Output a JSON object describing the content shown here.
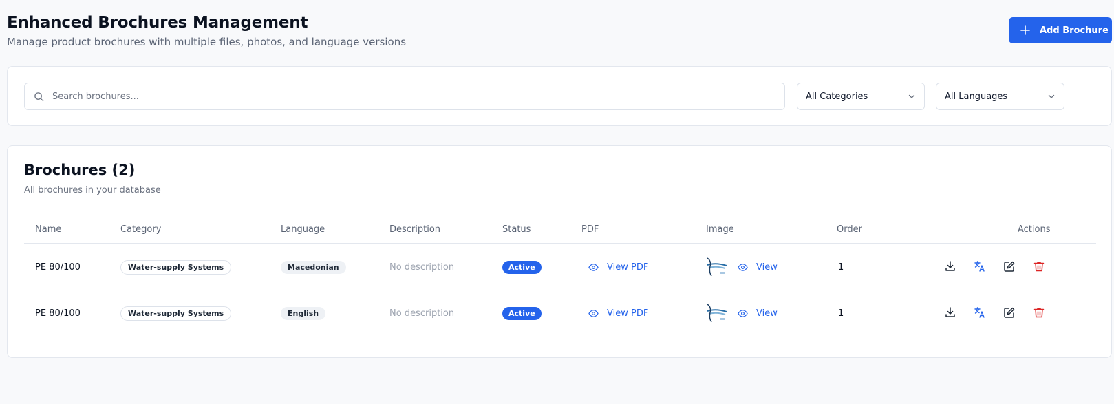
{
  "header": {
    "title": "Enhanced Brochures Management",
    "subtitle": "Manage product brochures with multiple files, photos, and language versions",
    "add_button": "Add Brochure"
  },
  "filters": {
    "search_placeholder": "Search brochures...",
    "category_select": "All Categories",
    "language_select": "All Languages"
  },
  "list": {
    "title": "Brochures (2)",
    "subtitle": "All brochures in your database",
    "columns": [
      "Name",
      "Category",
      "Language",
      "Description",
      "Status",
      "PDF",
      "Image",
      "Order",
      "Actions"
    ],
    "rows": [
      {
        "name": "PE 80/100",
        "category": "Water-supply Systems",
        "language": "Macedonian",
        "description": "No description",
        "status": "Active",
        "pdf_link": "View PDF",
        "image_link": "View",
        "order": "1"
      },
      {
        "name": "PE 80/100",
        "category": "Water-supply Systems",
        "language": "English",
        "description": "No description",
        "status": "Active",
        "pdf_link": "View PDF",
        "image_link": "View",
        "order": "1"
      }
    ]
  },
  "colors": {
    "accent": "#2463eb",
    "danger": "#dc2626",
    "background": "#f8f9fb"
  },
  "icons": {
    "search": "search-icon",
    "add": "plus-icon",
    "chevron": "chevron-down-icon",
    "view": "eye-icon",
    "download": "download-icon",
    "translate": "translate-icon",
    "edit": "edit-icon",
    "delete": "trash-icon"
  }
}
